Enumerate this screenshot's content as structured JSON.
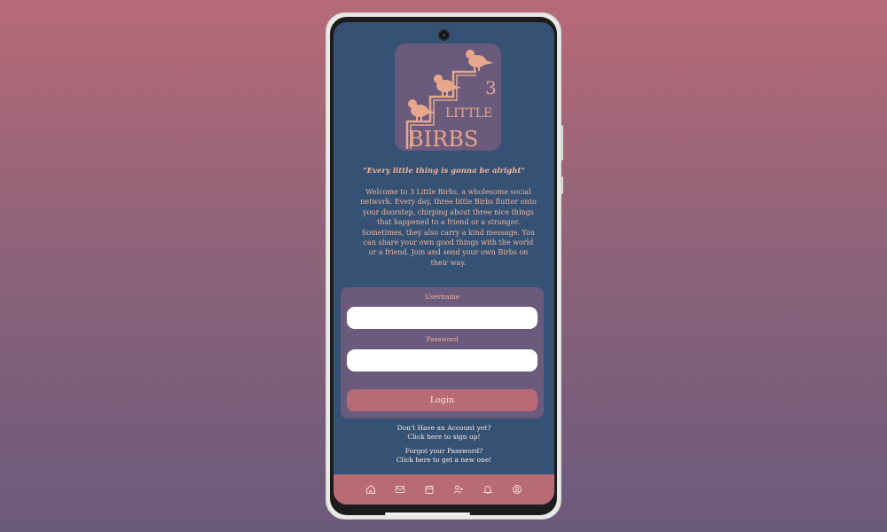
{
  "colors": {
    "screen_bg": "#355274",
    "accent": "#b86a77",
    "card_bg": "#6a5a7c",
    "text_peach": "#eeb49f",
    "logo_bird": "#e7a78c"
  },
  "logo": {
    "number": "3",
    "word_small": "LITTLE",
    "word_big": "BIRBS"
  },
  "tagline": "\"Every little thing is gonna be alright\"",
  "welcome": "Welcome to 3 Little Birbs, a wholesome social network. Every day, three little Birbs flutter onto your doorstep, chirping about three nice things that happened to a friend or a stranger. Sometimes, they also carry a kind message. You can share your own good things with the world or a friend. Join and send your own Birbs on their way.",
  "form": {
    "username_label": "Username",
    "username_value": "",
    "password_label": "Password",
    "password_value": "",
    "login_label": "Login"
  },
  "links": {
    "signup_line1": "Don't Have an Account yet?",
    "signup_line2": "Click here to sign up!",
    "forgot_line1": "Forgot your Password?",
    "forgot_line2": "Click here to get a new one!"
  },
  "nav": {
    "icons": [
      "home-icon",
      "mail-icon",
      "calendar-icon",
      "add-user-icon",
      "bell-icon",
      "profile-icon"
    ]
  }
}
